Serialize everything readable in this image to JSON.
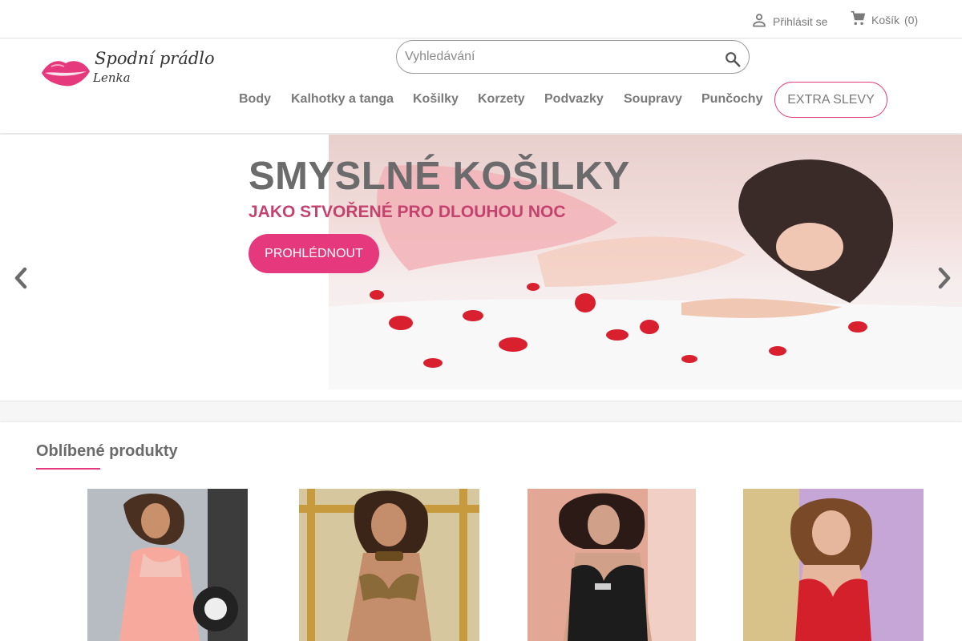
{
  "topbar": {
    "login_label": "Přihlásit se",
    "cart_label": "Košík",
    "cart_count": "(0)"
  },
  "logo": {
    "line1": "Spodní prádlo",
    "line2": "Lenka",
    "accent": "#e5387d"
  },
  "search": {
    "placeholder": "Vyhledávání",
    "value": ""
  },
  "nav": {
    "items": [
      "Body",
      "Kalhotky a tanga",
      "Košilky",
      "Korzety",
      "Podvazky",
      "Soupravy",
      "Punčochy"
    ],
    "extra_label": "EXTRA SLEVY"
  },
  "banner": {
    "title": "SMYSLNÉ KOŠILKY",
    "subtitle": "JAKO STVOŘENÉ PRO DLOUHOU NOC",
    "cta_label": "PROHLÉDNOUT",
    "prev_icon": "chevron-left-icon",
    "next_icon": "chevron-right-icon"
  },
  "featured": {
    "title": "Oblíbené produkty",
    "products": [
      {
        "name": "product-1",
        "color": "#f2a89a"
      },
      {
        "name": "product-2",
        "color": "#b88a5a"
      },
      {
        "name": "product-3",
        "color": "#2a2a2a"
      },
      {
        "name": "product-4",
        "color": "#d3202a"
      }
    ]
  },
  "colors": {
    "accent": "#e5387d",
    "text": "#7a7a7a",
    "subtitle": "#c4426e"
  }
}
